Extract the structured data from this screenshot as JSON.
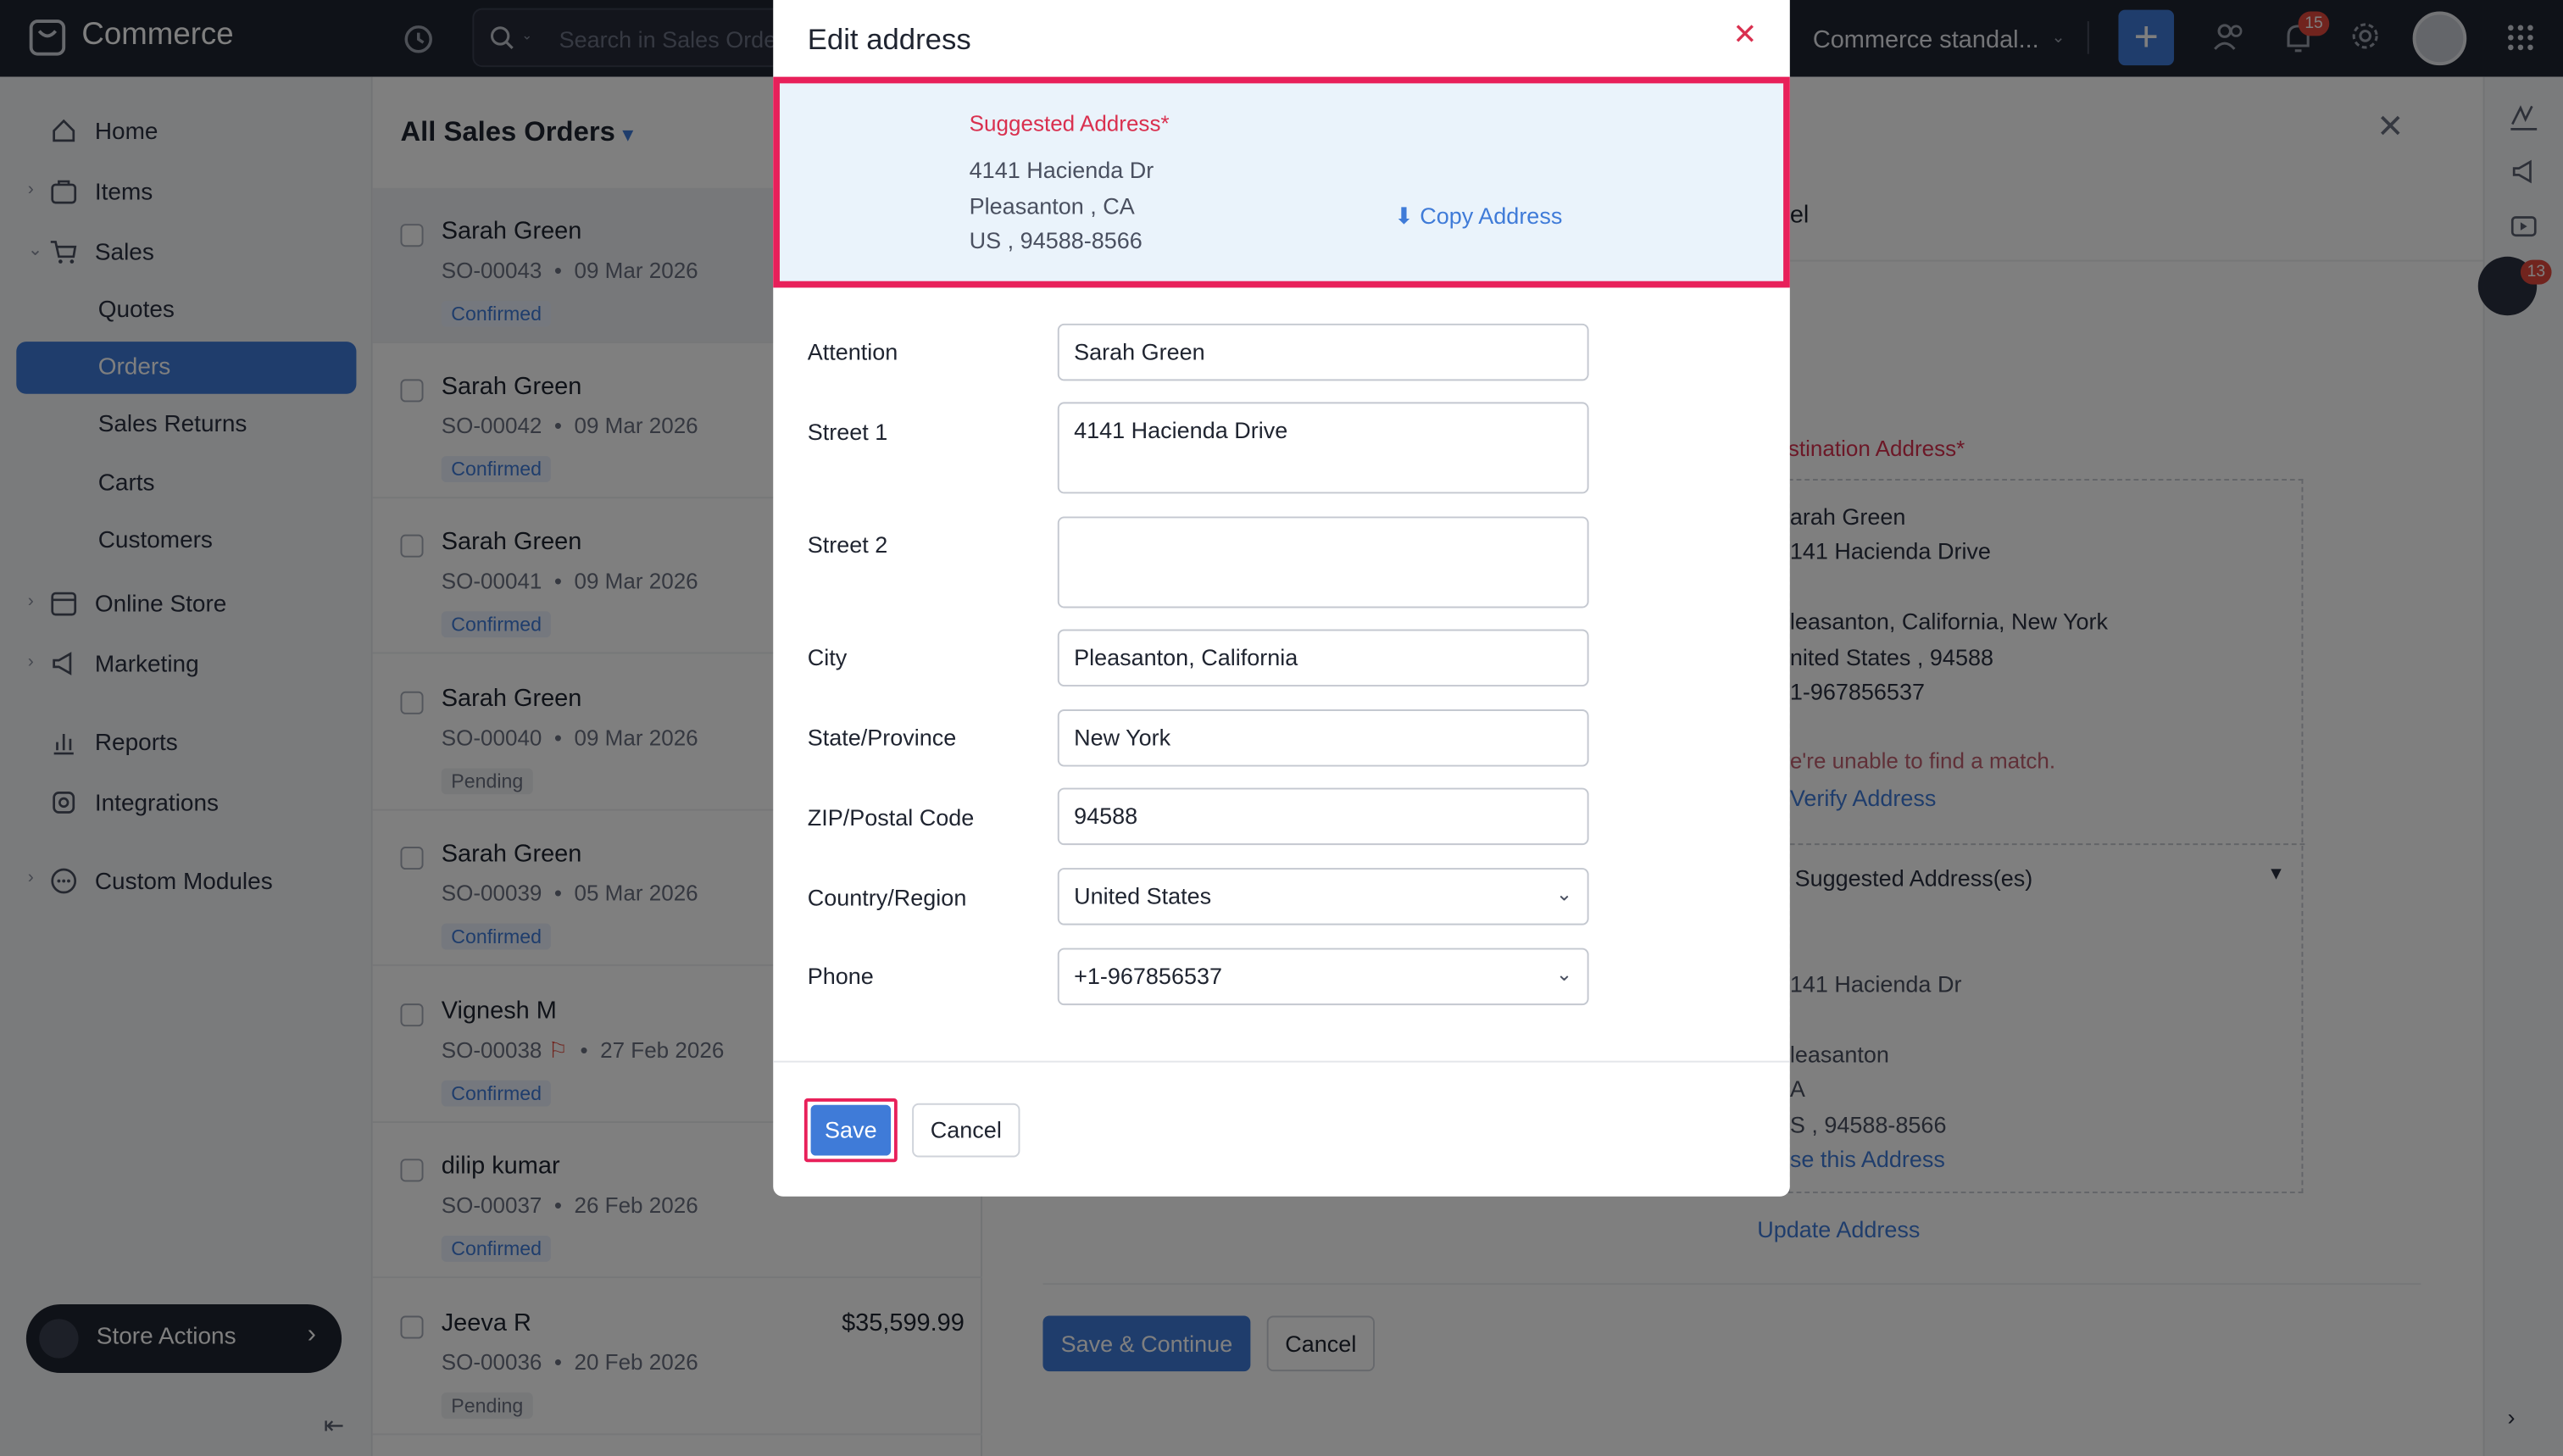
{
  "app": {
    "name": "Commerce"
  },
  "topbar": {
    "search_placeholder": "Search in Sales Orders ( / )",
    "org_name": "Commerce standal...",
    "notification_count": "15"
  },
  "sidebar": {
    "home": "Home",
    "items": "Items",
    "sales": "Sales",
    "quotes": "Quotes",
    "orders": "Orders",
    "sales_returns": "Sales Returns",
    "carts": "Carts",
    "customers": "Customers",
    "online_store": "Online Store",
    "marketing": "Marketing",
    "reports": "Reports",
    "integrations": "Integrations",
    "custom_modules": "Custom Modules",
    "store_actions": "Store Actions"
  },
  "list": {
    "title": "All Sales Orders",
    "orders": [
      {
        "customer": "Sarah Green",
        "number": "SO-00043",
        "date": "09 Mar 2026",
        "status": "Confirmed",
        "amount": ""
      },
      {
        "customer": "Sarah Green",
        "number": "SO-00042",
        "date": "09 Mar 2026",
        "status": "Confirmed",
        "amount": ""
      },
      {
        "customer": "Sarah Green",
        "number": "SO-00041",
        "date": "09 Mar 2026",
        "status": "Confirmed",
        "amount": ""
      },
      {
        "customer": "Sarah Green",
        "number": "SO-00040",
        "date": "09 Mar 2026",
        "status": "Pending",
        "amount": ""
      },
      {
        "customer": "Sarah Green",
        "number": "SO-00039",
        "date": "05 Mar 2026",
        "status": "Confirmed",
        "amount": ""
      },
      {
        "customer": "Vignesh M",
        "number": "SO-00038",
        "date": "27 Feb 2026",
        "status": "Confirmed",
        "amount": ""
      },
      {
        "customer": "dilip kumar",
        "number": "SO-00037",
        "date": "26 Feb 2026",
        "status": "Confirmed",
        "amount": ""
      },
      {
        "customer": "Jeeva R",
        "number": "SO-00036",
        "date": "20 Feb 2026",
        "status": "Pending",
        "amount": "$35,599.99"
      }
    ]
  },
  "detail": {
    "header_fragment": "el",
    "destination_label": "stination Address*",
    "dest_name": "arah Green",
    "dest_street": "141 Hacienda Drive",
    "dest_city": "leasanton, California, New York",
    "dest_country": "nited States , 94588",
    "dest_phone": "1-967856537",
    "no_match": "e're unable to find a match.",
    "verify": "Verify Address",
    "suggested_header": "Suggested Address(es)",
    "sugg_street": "141 Hacienda Dr",
    "sugg_city": "leasanton",
    "sugg_state": "A",
    "sugg_country": "S , 94588-8566",
    "use_address": "se this Address",
    "update_address": "Update Address",
    "save_continue": "Save & Continue",
    "cancel": "Cancel",
    "chat_badge": "13"
  },
  "modal": {
    "title": "Edit address",
    "suggested_label": "Suggested Address*",
    "suggested_lines": [
      "4141 Hacienda Dr",
      "Pleasanton , CA",
      "US , 94588-8566"
    ],
    "copy_address": "Copy Address",
    "fields": {
      "attention": {
        "label": "Attention",
        "value": "Sarah Green"
      },
      "street1": {
        "label": "Street 1",
        "value": "4141 Hacienda Drive"
      },
      "street2": {
        "label": "Street 2",
        "value": ""
      },
      "city": {
        "label": "City",
        "value": "Pleasanton, California"
      },
      "state": {
        "label": "State/Province",
        "value": "New York"
      },
      "zip": {
        "label": "ZIP/Postal Code",
        "value": "94588"
      },
      "country": {
        "label": "Country/Region",
        "value": "United States"
      },
      "phone": {
        "label": "Phone",
        "value": "+1-967856537"
      }
    },
    "save": "Save",
    "cancel": "Cancel"
  },
  "colors": {
    "accent": "#3f7bd8",
    "highlight": "#e8205a",
    "topbar": "#1f2430",
    "required": "#d9304f"
  }
}
